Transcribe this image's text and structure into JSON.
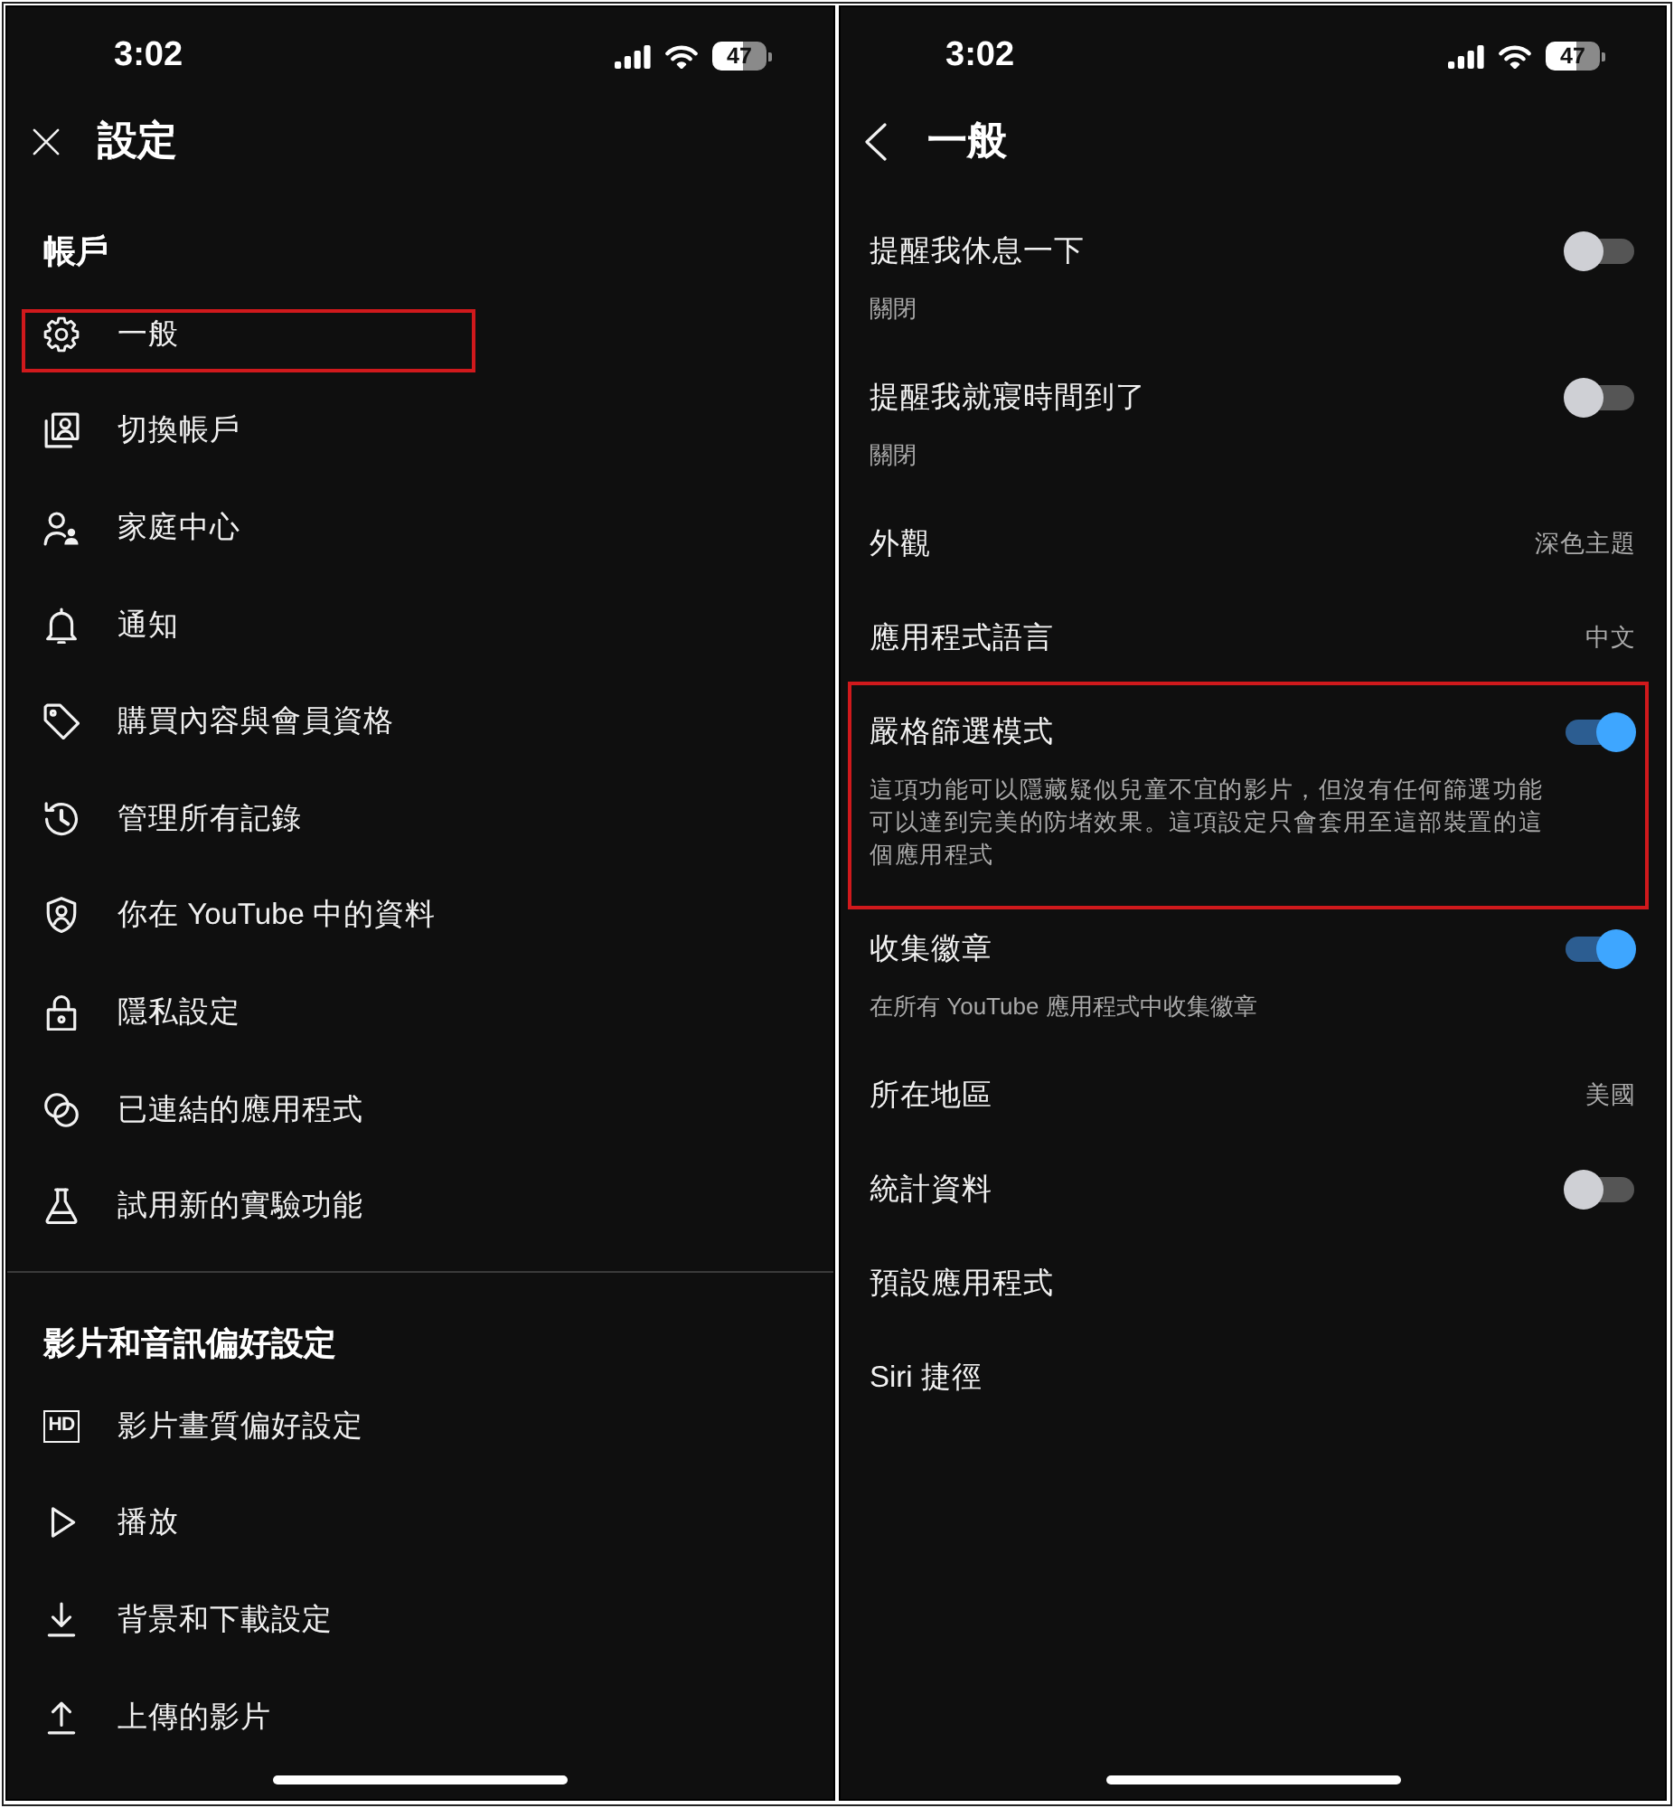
{
  "settings_screen": {
    "status_bar": {
      "time": "3:02",
      "battery": "47"
    },
    "title": "設定",
    "sections": [
      {
        "heading": "帳戶",
        "items": [
          {
            "label": "一般",
            "highlighted": true
          },
          {
            "label": "切換帳戶",
            "highlighted": false
          },
          {
            "label": "家庭中心",
            "highlighted": false
          },
          {
            "label": "通知",
            "highlighted": false
          },
          {
            "label": "購買內容與會員資格",
            "highlighted": false
          },
          {
            "label": "管理所有記錄",
            "highlighted": false
          },
          {
            "label": "你在 YouTube 中的資料",
            "highlighted": false
          },
          {
            "label": "隱私設定",
            "highlighted": false
          },
          {
            "label": "已連結的應用程式",
            "highlighted": false
          },
          {
            "label": "試用新的實驗功能",
            "highlighted": false
          }
        ]
      },
      {
        "heading": "影片和音訊偏好設定",
        "items": [
          {
            "label": "影片畫質偏好設定",
            "icon_text": "HD",
            "highlighted": false
          },
          {
            "label": "播放",
            "highlighted": false
          },
          {
            "label": "背景和下載設定",
            "highlighted": false
          },
          {
            "label": "上傳的影片",
            "highlighted": false
          }
        ]
      }
    ]
  },
  "general_screen": {
    "status_bar": {
      "time": "3:02",
      "battery": "47"
    },
    "title": "一般",
    "rows": [
      {
        "kind": "toggle",
        "title": "提醒我休息一下",
        "subtitle": "關閉",
        "on": false,
        "highlighted": false
      },
      {
        "kind": "toggle",
        "title": "提醒我就寢時間到了",
        "subtitle": "關閉",
        "on": false,
        "highlighted": false
      },
      {
        "kind": "value",
        "title": "外觀",
        "value": "深色主題",
        "highlighted": false
      },
      {
        "kind": "value",
        "title": "應用程式語言",
        "value": "中文",
        "highlighted": false
      },
      {
        "kind": "toggle",
        "title": "嚴格篩選模式",
        "description": "這項功能可以隱藏疑似兒童不宜的影片，但沒有任何篩選功能可以達到完美的防堵效果。這項設定只會套用至這部裝置的這個應用程式",
        "on": true,
        "highlighted": true
      },
      {
        "kind": "toggle",
        "title": "收集徽章",
        "subtitle": "在所有 YouTube 應用程式中收集徽章",
        "on": true,
        "highlighted": false
      },
      {
        "kind": "value",
        "title": "所在地區",
        "value": "美國",
        "highlighted": false
      },
      {
        "kind": "toggle",
        "title": "統計資料",
        "on": false,
        "highlighted": false
      },
      {
        "kind": "plain",
        "title": "預設應用程式",
        "highlighted": false
      },
      {
        "kind": "plain",
        "title": "Siri 捷徑",
        "highlighted": false
      }
    ]
  }
}
